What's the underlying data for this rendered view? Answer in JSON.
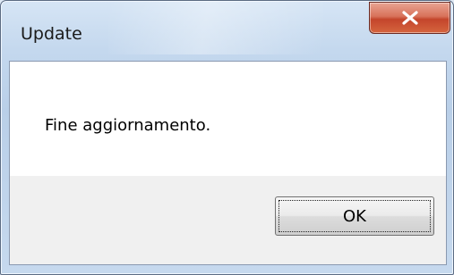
{
  "window": {
    "title": "Update",
    "close_icon": "close-icon"
  },
  "dialog": {
    "message": "Fine aggiornamento.",
    "ok_label": "OK"
  },
  "colors": {
    "close_button": "#c4452b",
    "content_background": "#ffffff",
    "button_area": "#f0f0f0"
  }
}
